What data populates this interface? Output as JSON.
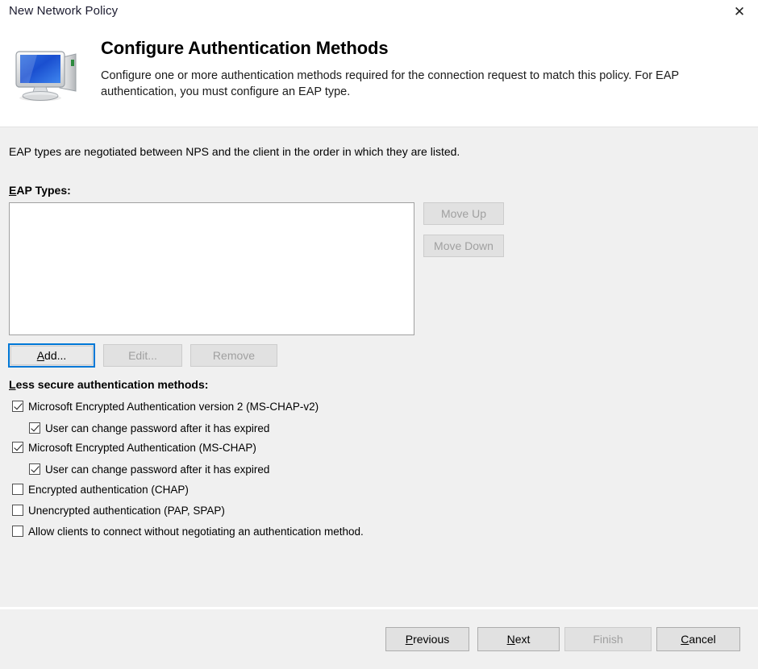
{
  "window": {
    "title": "New Network Policy",
    "close_label": "✕"
  },
  "header": {
    "title": "Configure Authentication Methods",
    "description": "Configure one or more authentication methods required for the connection request to match this policy. For EAP authentication, you must configure an EAP type.",
    "icon": "computer-monitor-icon"
  },
  "body": {
    "intro": "EAP types are negotiated between NPS and the client in the order in which they are listed.",
    "eap_types_label": "EAP Types:",
    "eap_types_accelerator": "E",
    "eap_types_items": [],
    "move_up_label": "Move Up",
    "move_down_label": "Move Down",
    "add_label": "Add...",
    "add_accelerator": "A",
    "edit_label": "Edit...",
    "remove_label": "Remove",
    "less_secure_label": "Less secure authentication methods:",
    "less_secure_accelerator": "L",
    "checkboxes": [
      {
        "label": "Microsoft Encrypted Authentication version 2 (MS-CHAP-v2)",
        "checked": true,
        "indent": false
      },
      {
        "label": "User can change password after it has expired",
        "checked": true,
        "indent": true
      },
      {
        "label": "Microsoft Encrypted Authentication (MS-CHAP)",
        "checked": true,
        "indent": false
      },
      {
        "label": "User can change password after it has expired",
        "checked": true,
        "indent": true
      },
      {
        "label": "Encrypted authentication (CHAP)",
        "checked": false,
        "indent": false
      },
      {
        "label": "Unencrypted authentication (PAP, SPAP)",
        "checked": false,
        "indent": false
      },
      {
        "label": "Allow clients to connect without negotiating an authentication method.",
        "checked": false,
        "indent": false
      }
    ]
  },
  "footer": {
    "previous_label": "Previous",
    "previous_accelerator": "P",
    "next_label": "Next",
    "next_accelerator": "N",
    "finish_label": "Finish",
    "cancel_label": "Cancel",
    "cancel_accelerator": "C"
  },
  "colors": {
    "accent": "#0078d7",
    "header_bg": "#ffffff",
    "body_bg": "#f0f0f0",
    "button_face": "#e1e1e1",
    "disabled_text": "#a0a0a0"
  }
}
